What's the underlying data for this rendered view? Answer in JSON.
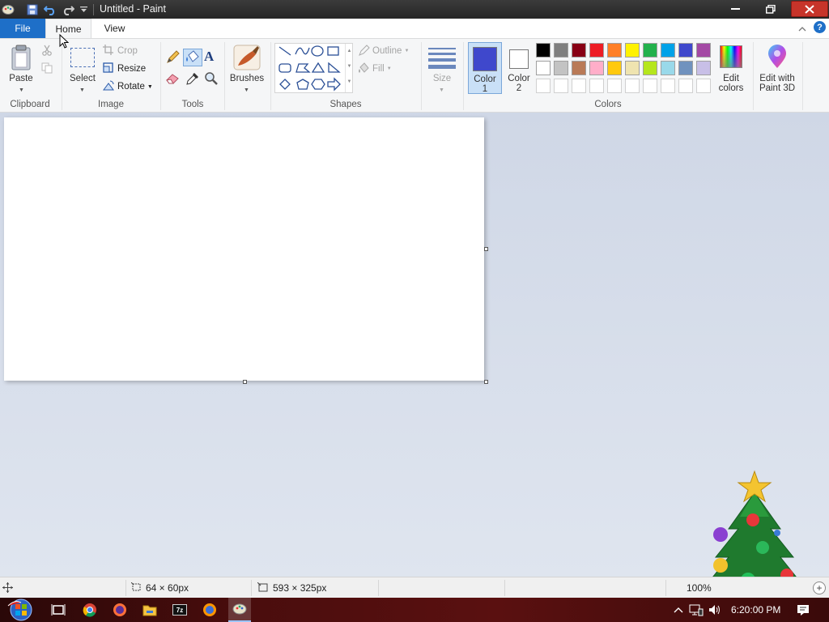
{
  "window": {
    "title": "Untitled - Paint",
    "controls": {
      "minimize": "—",
      "maximize": "❐",
      "close": "✕"
    }
  },
  "tabs": {
    "file": "File",
    "home": "Home",
    "view": "View"
  },
  "ribbon": {
    "clipboard": {
      "paste": "Paste",
      "group": "Clipboard"
    },
    "image": {
      "select": "Select",
      "crop": "Crop",
      "resize": "Resize",
      "rotate": "Rotate",
      "group": "Image"
    },
    "tools": {
      "group": "Tools"
    },
    "brushes": {
      "label": "Brushes"
    },
    "shapes": {
      "outline": "Outline",
      "fill": "Fill",
      "group": "Shapes"
    },
    "size": {
      "label": "Size"
    },
    "colors": {
      "color1": "Color\n1",
      "color1_a": "Color",
      "color1_b": "1",
      "color2_a": "Color",
      "color2_b": "2",
      "edit_colors_a": "Edit",
      "edit_colors_b": "colors",
      "paint3d_a": "Edit with",
      "paint3d_b": "Paint 3D",
      "group": "Colors",
      "color1_value": "#3f48cc",
      "color2_value": "#ffffff",
      "palette_row1": [
        "#000000",
        "#7f7f7f",
        "#880015",
        "#ed1c24",
        "#ff7f27",
        "#fff200",
        "#22b14c",
        "#00a2e8",
        "#3f48cc",
        "#a349a4"
      ],
      "palette_row2": [
        "#ffffff",
        "#c3c3c3",
        "#b97a57",
        "#ffaec9",
        "#ffc90e",
        "#efe4b0",
        "#b5e61d",
        "#99d9ea",
        "#7092be",
        "#c8bfe7"
      ]
    }
  },
  "status": {
    "selection_size": "64 × 60px",
    "canvas_size": "593 × 325px",
    "zoom": "100%"
  },
  "taskbar": {
    "clock": "6:20:00 PM"
  },
  "icons": [
    "paint-app-icon",
    "save-icon",
    "undo-icon",
    "redo-icon",
    "paste-icon",
    "cut-icon",
    "copy-icon",
    "select-icon",
    "crop-icon",
    "resize-icon",
    "rotate-icon",
    "pencil-icon",
    "fill-icon",
    "text-icon",
    "eraser-icon",
    "color-picker-icon",
    "magnifier-icon",
    "brushes-icon",
    "size-icon",
    "edit-colors-icon",
    "paint3d-icon",
    "help-icon",
    "christmas-tree-icon"
  ]
}
